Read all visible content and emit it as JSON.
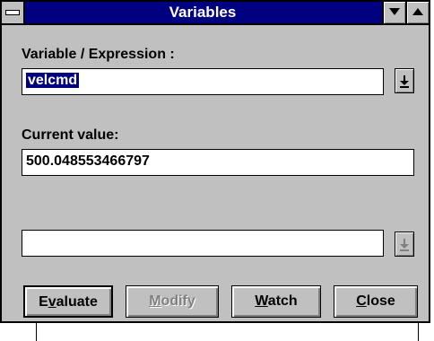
{
  "window": {
    "title": "Variables"
  },
  "expression": {
    "label": "Variable / Expression :",
    "value": "velcmd"
  },
  "current": {
    "label": "Current value:",
    "value": "500.048553466797"
  },
  "new_value": {
    "value": ""
  },
  "buttons": {
    "evaluate": {
      "pre": "E",
      "key": "v",
      "post": "aluate"
    },
    "modify": {
      "pre": "",
      "key": "M",
      "post": "odify"
    },
    "watch": {
      "pre": "",
      "key": "W",
      "post": "atch"
    },
    "close": {
      "pre": "",
      "key": "C",
      "post": "lose"
    }
  },
  "colors": {
    "titlebar": "#000080",
    "face": "#c0c0c0",
    "selection": "#000080"
  },
  "icons": {
    "system_menu": "system-menu-icon",
    "minimize": "triangle-down-icon",
    "maximize": "triangle-up-icon",
    "dropdown": "dropdown-arrow-icon"
  }
}
